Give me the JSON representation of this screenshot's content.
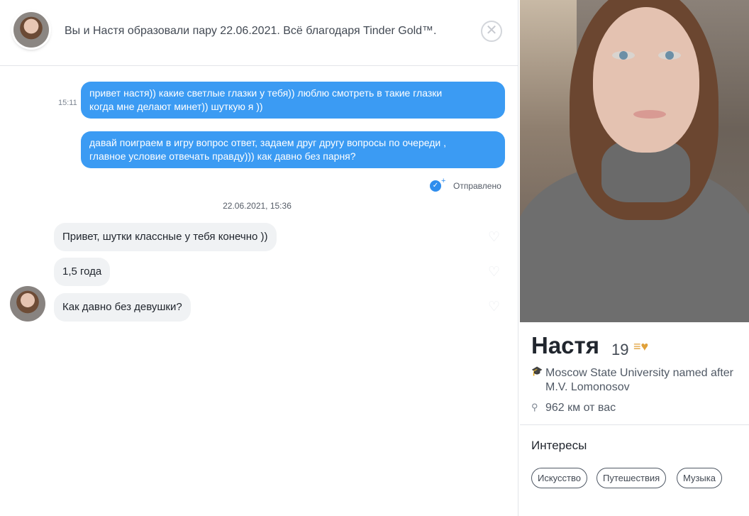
{
  "header": {
    "match_text": "Вы и Настя образовали пару 22.06.2021. Всё благодаря Tinder Gold™.",
    "close_symbol": "✕"
  },
  "messages_out": [
    {
      "time": "15:11",
      "line1": "привет настя))  какие светлые глазки у тебя)) люблю смотреть в такие глазки",
      "line2": "когда мне делают минет)) шуткую я ))"
    },
    {
      "line1": "давай поиграем в игру вопрос ответ, задаем друг другу вопросы по очереди ,",
      "line2": "главное условие отвечать правду))) как давно без парня?"
    }
  ],
  "status": {
    "label": "Отправлено",
    "check": "✓",
    "plus": "+"
  },
  "date_divider": "22.06.2021, 15:36",
  "messages_in": [
    {
      "text": "Привет, шутки классные у тебя конечно ))"
    },
    {
      "text": "1,5 года"
    },
    {
      "text": "Как давно без девушки?"
    }
  ],
  "heart_symbol": "♡",
  "profile": {
    "name": "Настя",
    "age": "19",
    "gold_icon": "≡♥",
    "school_icon": "🎓",
    "school_line1": "Moscow State University named after",
    "school_line2": "M.V. Lomonosov",
    "pin_icon": "⚲",
    "distance": "962 км от вас",
    "interests_title": "Интересы",
    "interests": [
      "Искусство",
      "Путешествия",
      "Музыка"
    ]
  }
}
